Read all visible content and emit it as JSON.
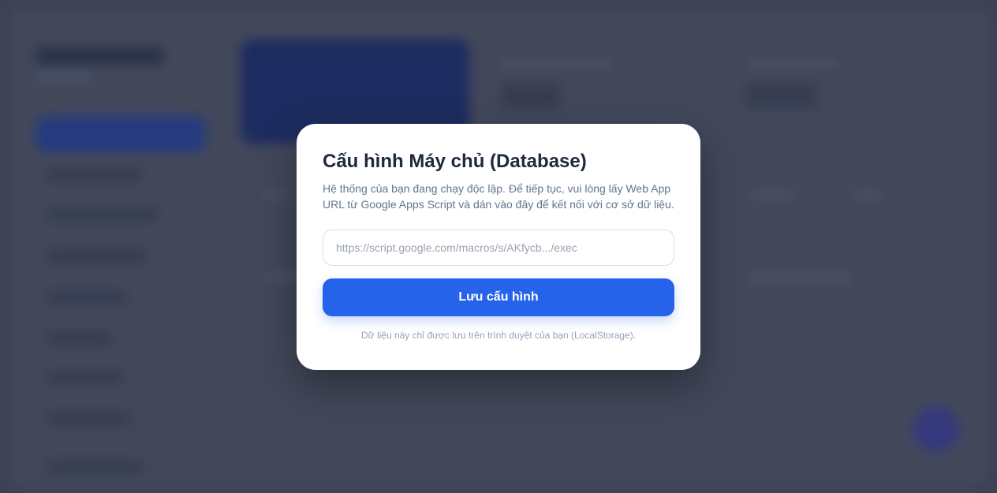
{
  "modal": {
    "title": "Cấu hình Máy chủ (Database)",
    "description": "Hệ thống của bạn đang chạy độc lập. Để tiếp tục, vui lòng lấy Web App URL từ Google Apps Script và dán vào đây để kết nối với cơ sở dữ liệu.",
    "url_input": {
      "value": "",
      "placeholder": "https://script.google.com/macros/s/AKfycb.../exec"
    },
    "save_label": "Lưu cấu hình",
    "note": "Dữ liệu này chỉ được lưu trên trình duyệt của bạn (LocalStorage)."
  },
  "colors": {
    "accent": "#2563eb",
    "overlay_background": "#444a5c",
    "modal_background": "#ffffff",
    "title_text": "#1e293b",
    "muted_text": "#64748b"
  }
}
